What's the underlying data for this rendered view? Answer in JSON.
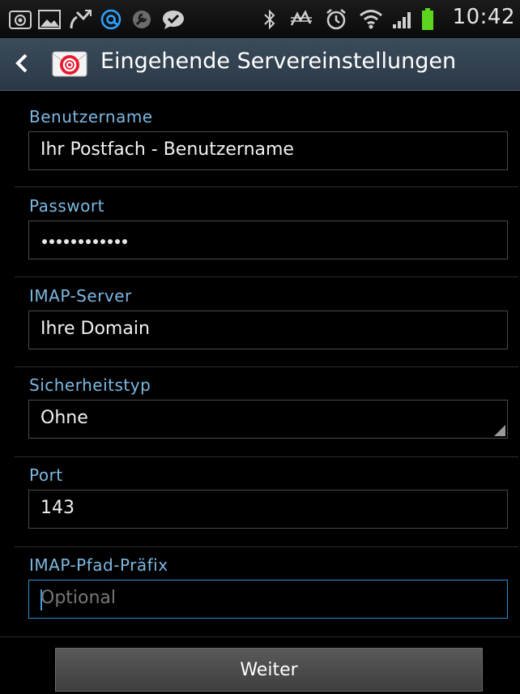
{
  "status_bar": {
    "time": "10:42",
    "icons": [
      "camera-icon",
      "image-icon",
      "missed-call-icon",
      "at-icon",
      "wrench-icon",
      "chat-icon",
      "bluetooth-icon",
      "nfc-icon",
      "alarm-icon",
      "wifi-icon",
      "signal-icon",
      "battery-icon"
    ],
    "accent_color": "#2ea3ff",
    "battery_color": "#5cd61c"
  },
  "action_bar": {
    "title": "Eingehende Servereinstellungen",
    "app_icon": "email-at-icon"
  },
  "form": {
    "username": {
      "label": "Benutzername",
      "value": "Ihr Postfach - Benutzername"
    },
    "password": {
      "label": "Passwort",
      "masked_length": 12
    },
    "server": {
      "label": "IMAP-Server",
      "value": "Ihre Domain"
    },
    "security": {
      "label": "Sicherheitstyp",
      "value": "Ohne"
    },
    "port": {
      "label": "Port",
      "value": "143"
    },
    "path_prefix": {
      "label": "IMAP-Pfad-Präfix",
      "placeholder": "Optional"
    }
  },
  "footer": {
    "next_label": "Weiter"
  },
  "colors": {
    "label": "#7db8e3",
    "focus_border": "#2d8fd0",
    "background": "#000000",
    "action_bar": "#33424f"
  }
}
